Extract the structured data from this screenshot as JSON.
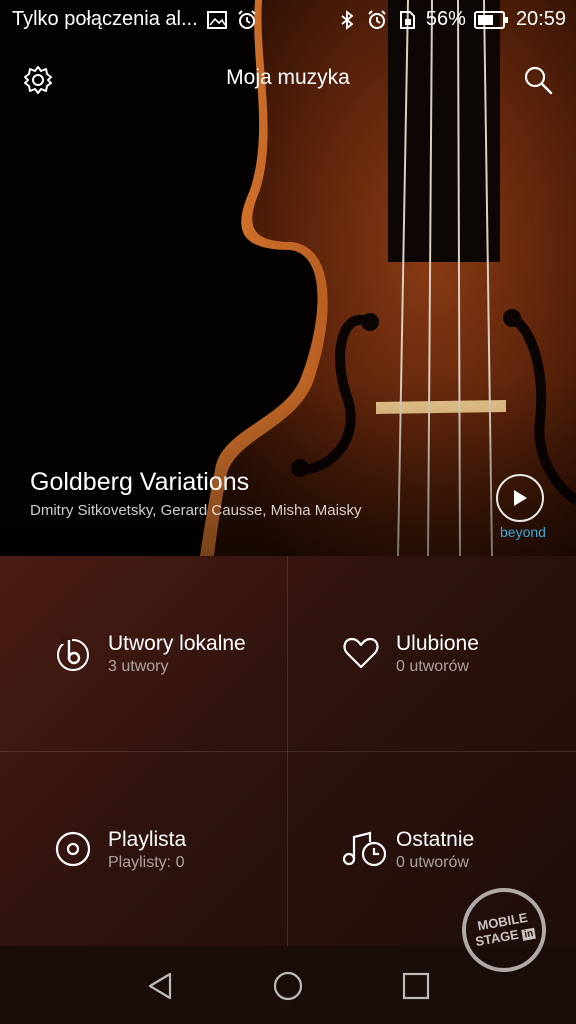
{
  "status_bar": {
    "notification": "Tylko połączenia al...",
    "battery": "56%",
    "time": "20:59"
  },
  "header": {
    "title": "Moja muzyka",
    "settings_icon": "gear-icon",
    "search_icon": "search-icon"
  },
  "now_playing": {
    "album_title": "Goldberg Variations",
    "artists": "Dmitry Sitkovetsky, Gerard Causse, Misha Maisky",
    "brand": "beyond"
  },
  "library": [
    {
      "title": "Utwory lokalne",
      "subtitle": "3 utwory",
      "icon": "local-songs-icon"
    },
    {
      "title": "Ulubione",
      "subtitle": "0 utworów",
      "icon": "heart-icon"
    },
    {
      "title": "Playlista",
      "subtitle": "Playlisty: 0",
      "icon": "disc-icon"
    },
    {
      "title": "Ostatnie",
      "subtitle": "0 utworów",
      "icon": "recent-music-icon"
    }
  ],
  "watermark": {
    "line1": "MOBILE",
    "line2": "STAGE",
    "badge": "in"
  },
  "colors": {
    "accent_beyond": "#3aa8d8",
    "panel": "#2e120d"
  }
}
